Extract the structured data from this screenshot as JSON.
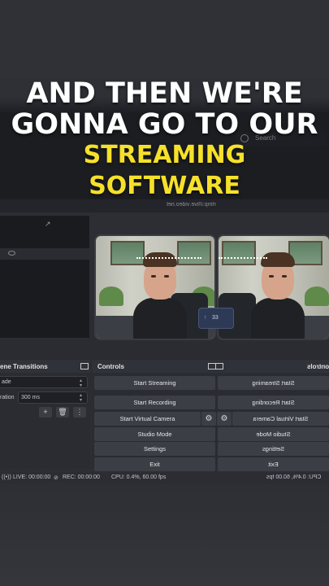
{
  "caption": {
    "line1": "AND THEN WE'RE",
    "line2": "GONNA GO TO OUR",
    "line3": "STREAMING",
    "line4": "SOFTWARE"
  },
  "search": {
    "placeholder": "Search"
  },
  "stream_url": "rtmp://live.video.net",
  "scene_transitions": {
    "title": "ene Transitions",
    "transition_value": "ade",
    "duration_label": "ration",
    "duration_value": "300 ms",
    "add": "+",
    "remove": "🗑",
    "more": "⋮"
  },
  "controls": {
    "title": "Controls",
    "title_mirror": "ontrols",
    "buttons": [
      "Start Streaming",
      "Start Recording",
      "Start Virtual Camera",
      "Studio Mode",
      "Settings",
      "Exit"
    ],
    "buttons_mirror": [
      "Start Streaming",
      "Start Recording",
      "Start Virtual Camera",
      "Studio Mode",
      "Settings",
      "Exit"
    ],
    "gear": "⚙"
  },
  "status": {
    "live": "LIVE: 00:00:00",
    "rec": "REC: 00:00:00",
    "cpu": "CPU: 0.4%, 60.00 fps",
    "cpu_mirror": "CPU: 0.4%, 60.00 fps"
  },
  "mic_chip": {
    "arrow": "↑",
    "level": "33"
  },
  "colors": {
    "caption_yellow": "#f6e12a",
    "panel": "#2a2c32",
    "button": "#3b3e45"
  }
}
